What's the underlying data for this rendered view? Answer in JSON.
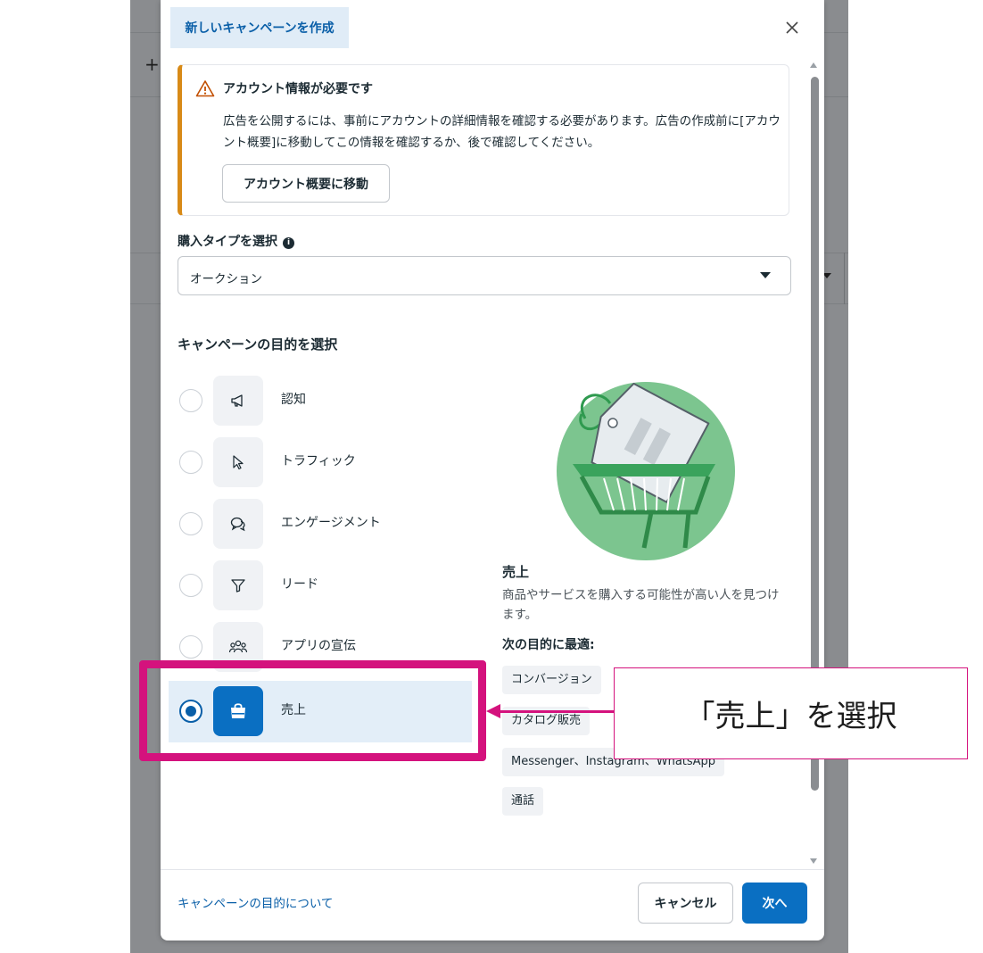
{
  "modal": {
    "title": "新しいキャンペーンを作成"
  },
  "alert": {
    "title": "アカウント情報が必要です",
    "body": "広告を公開するには、事前にアカウントの詳細情報を確認する必要があります。広告の作成前に[アカウント概要]に移動してこの情報を確認するか、後で確認してください。",
    "button_label": "アカウント概要に移動"
  },
  "purchase_type": {
    "label": "購入タイプを選択",
    "value": "オークション"
  },
  "objectives": {
    "heading": "キャンペーンの目的を選択",
    "items": [
      {
        "label": "認知",
        "icon": "megaphone-icon",
        "selected": false
      },
      {
        "label": "トラフィック",
        "icon": "cursor-icon",
        "selected": false
      },
      {
        "label": "エンゲージメント",
        "icon": "chat-bubbles-icon",
        "selected": false
      },
      {
        "label": "リード",
        "icon": "funnel-icon",
        "selected": false
      },
      {
        "label": "アプリの宣伝",
        "icon": "people-icon",
        "selected": false
      },
      {
        "label": "売上",
        "icon": "shopping-bag-icon",
        "selected": true
      }
    ]
  },
  "description": {
    "title": "売上",
    "text": "商品やサービスを購入する可能性が高い人を見つけます。",
    "best_for_label": "次の目的に最適:",
    "chips": [
      "コンバージョン",
      "カタログ販売",
      "Messenger、Instagram、WhatsApp",
      "通話"
    ]
  },
  "annotation": {
    "callout_text": "「売上」を選択",
    "color": "#d4127d"
  },
  "footer": {
    "help_link": "キャンペーンの目的について",
    "cancel_label": "キャンセル",
    "next_label": "次へ"
  },
  "colors": {
    "accent": "#0a6fc2",
    "warning": "#d88a17"
  }
}
